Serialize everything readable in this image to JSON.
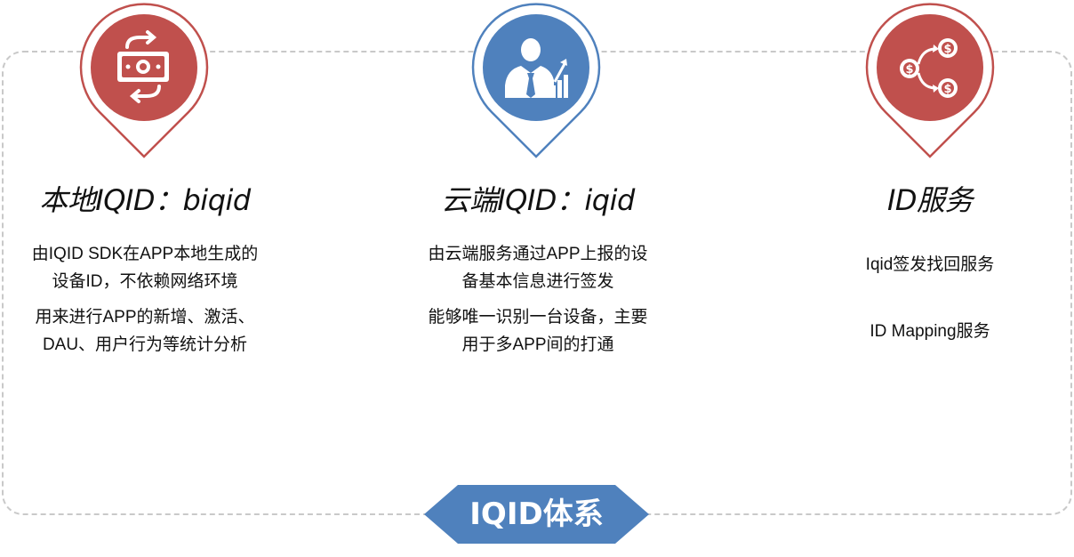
{
  "columns": [
    {
      "title": "本地IQID：biqid",
      "paragraphs": [
        "由IQID SDK在APP本地生成的\n设备ID，不依赖网络环境",
        "用来进行APP的新增、激活、\nDAU、用户行为等统计分析"
      ],
      "icon": "money-exchange-icon",
      "color": "#c0504d"
    },
    {
      "title": "云端IQID：iqid",
      "paragraphs": [
        "由云端服务通过APP上报的设\n备基本信息进行签发",
        "能够唯一识别一台设备，主要\n用于多APP间的打通"
      ],
      "icon": "businessman-growth-icon",
      "color": "#4f81bd"
    },
    {
      "title": "ID服务",
      "paragraphs": [
        "Iqid签发找回服务",
        "ID Mapping服务"
      ],
      "icon": "dollar-split-icon",
      "color": "#c0504d"
    }
  ],
  "banner": {
    "label": "IQID体系",
    "color": "#4f81bd"
  }
}
